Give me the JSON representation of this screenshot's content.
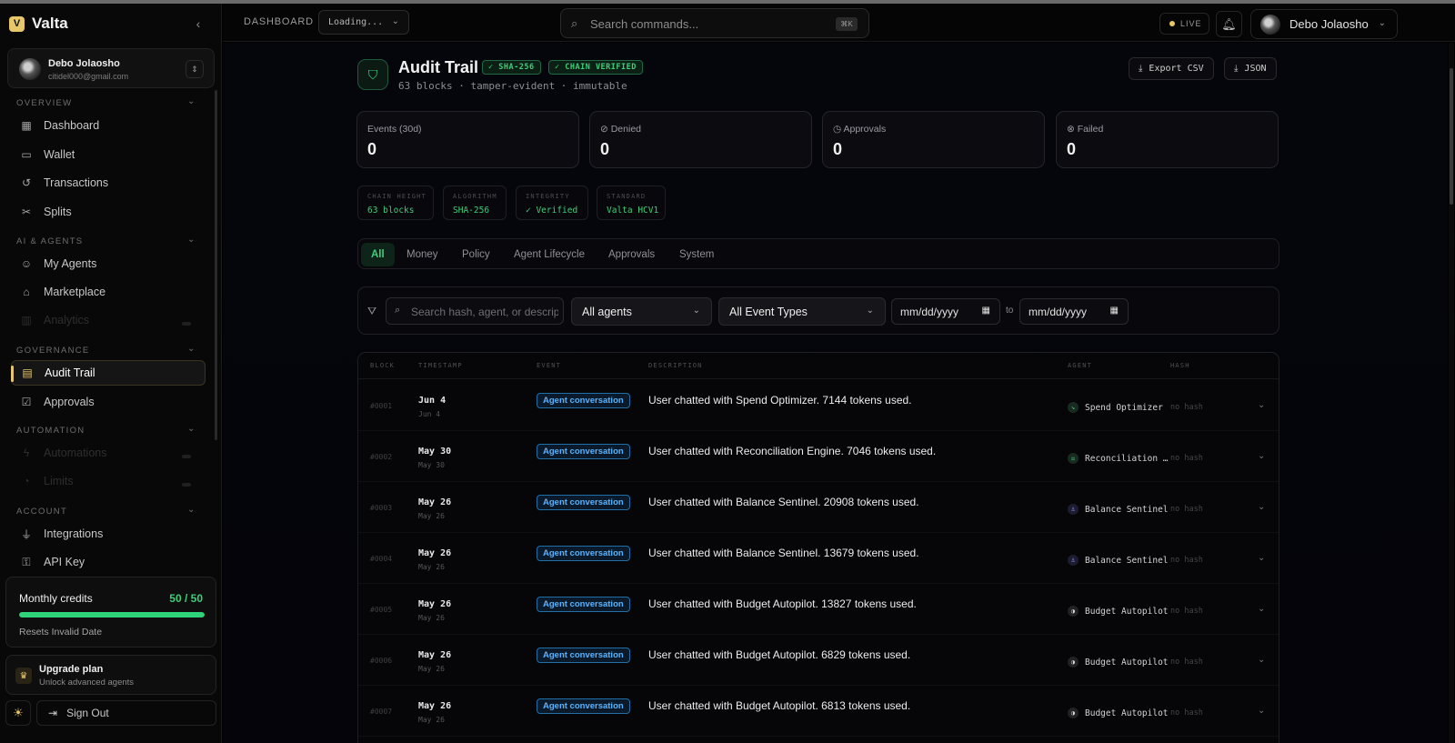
{
  "brand": {
    "name": "Valta",
    "logo_letter": "V"
  },
  "sidebar": {
    "user": {
      "name": "Debo Jolaosho",
      "email": "citidel000@gmail.com"
    },
    "sections": [
      {
        "label": "Overview",
        "items": [
          "Dashboard",
          "Wallet",
          "Transactions",
          "Splits"
        ]
      },
      {
        "label": "AI & Agents",
        "items": [
          "My Agents",
          "Marketplace",
          "Analytics"
        ]
      },
      {
        "label": "Governance",
        "items": [
          "Audit Trail",
          "Approvals"
        ]
      },
      {
        "label": "Automation",
        "items": [
          "Automations",
          "Limits"
        ]
      },
      {
        "label": "Account",
        "items": [
          "Integrations",
          "API Key"
        ]
      }
    ],
    "active_item": "Audit Trail",
    "credits": {
      "title": "Monthly credits",
      "count": "50 / 50",
      "used_fraction": 1.0,
      "reset": "Resets Invalid Date"
    },
    "upgrade": {
      "title": "Upgrade plan",
      "subtitle": "Unlock advanced agents"
    },
    "sign_out": "Sign Out"
  },
  "topbar": {
    "breadcrumb": "DASHBOARD",
    "loading_select": "Loading...",
    "search_placeholder": "Search commands...",
    "search_kbd": "⌘K",
    "live": "LIVE",
    "user_name": "Debo Jolaosho"
  },
  "page": {
    "title": "Audit Trail",
    "badges": [
      "✓ SHA-256",
      "✓ CHAIN VERIFIED"
    ],
    "subtitle": "63 blocks · tamper-evident · immutable",
    "actions": {
      "export_csv": "Export CSV",
      "json": "JSON"
    }
  },
  "stats": [
    {
      "label": "Events (30d)",
      "value": "0"
    },
    {
      "label": "Denied",
      "value": "0"
    },
    {
      "label": "Approvals",
      "value": "0"
    },
    {
      "label": "Failed",
      "value": "0"
    }
  ],
  "meta": [
    {
      "key": "CHAIN HEIGHT",
      "value": "63 blocks"
    },
    {
      "key": "ALGORITHM",
      "value": "SHA-256"
    },
    {
      "key": "INTEGRITY",
      "value": "✓ Verified"
    },
    {
      "key": "STANDARD",
      "value": "Valta HCV1"
    }
  ],
  "tabs": [
    "All",
    "Money",
    "Policy",
    "Agent Lifecycle",
    "Approvals",
    "System"
  ],
  "active_tab": "All",
  "filters": {
    "search_placeholder": "Search hash, agent, or description",
    "agent_select": "All agents",
    "event_select": "All Event Types",
    "date_from": "mm/dd/yyyy",
    "date_to": "mm/dd/yyyy",
    "to_label": "to"
  },
  "table": {
    "columns": [
      "BLOCK",
      "TIMESTAMP",
      "EVENT",
      "DESCRIPTION",
      "AGENT",
      "HASH"
    ],
    "rows": [
      {
        "block": "#0001",
        "date": "Jun 4",
        "date_sub": "Jun 4",
        "event": "Agent conversation",
        "description": "User chatted with Spend Optimizer. 7144 tokens used.",
        "agent": "Spend Optimizer",
        "hash": "no hash"
      },
      {
        "block": "#0002",
        "date": "May 30",
        "date_sub": "May 30",
        "event": "Agent conversation",
        "description": "User chatted with Reconciliation Engine. 7046 tokens used.",
        "agent": "Reconciliation …",
        "hash": "no hash"
      },
      {
        "block": "#0003",
        "date": "May 26",
        "date_sub": "May 26",
        "event": "Agent conversation",
        "description": "User chatted with Balance Sentinel. 20908 tokens used.",
        "agent": "Balance Sentinel",
        "hash": "no hash"
      },
      {
        "block": "#0004",
        "date": "May 26",
        "date_sub": "May 26",
        "event": "Agent conversation",
        "description": "User chatted with Balance Sentinel. 13679 tokens used.",
        "agent": "Balance Sentinel",
        "hash": "no hash"
      },
      {
        "block": "#0005",
        "date": "May 26",
        "date_sub": "May 26",
        "event": "Agent conversation",
        "description": "User chatted with Budget Autopilot. 13827 tokens used.",
        "agent": "Budget Autopilot",
        "hash": "no hash"
      },
      {
        "block": "#0006",
        "date": "May 26",
        "date_sub": "May 26",
        "event": "Agent conversation",
        "description": "User chatted with Budget Autopilot. 6829 tokens used.",
        "agent": "Budget Autopilot",
        "hash": "no hash"
      },
      {
        "block": "#0007",
        "date": "May 26",
        "date_sub": "May 26",
        "event": "Agent conversation",
        "description": "User chatted with Budget Autopilot. 6813 tokens used.",
        "agent": "Budget Autopilot",
        "hash": "no hash"
      }
    ]
  }
}
